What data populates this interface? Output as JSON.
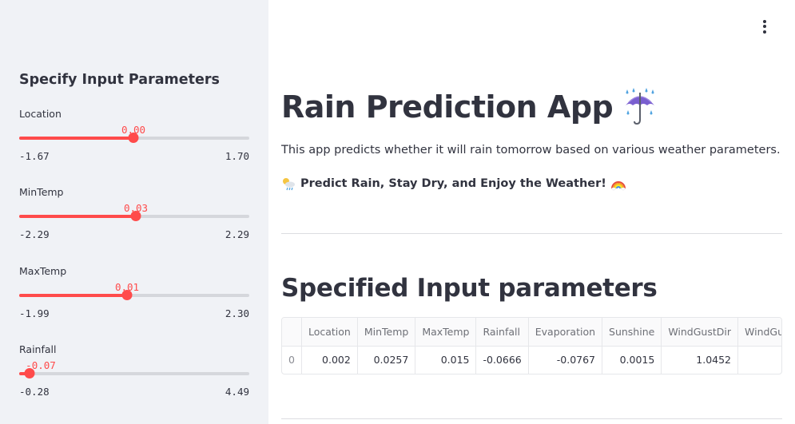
{
  "sidebar": {
    "title": "Specify Input Parameters",
    "sliders": [
      {
        "label": "Location",
        "value": "0.00",
        "min": "-1.67",
        "max": "1.70",
        "fraction": 0.496
      },
      {
        "label": "MinTemp",
        "value": "0.03",
        "min": "-2.29",
        "max": "2.29",
        "fraction": 0.507
      },
      {
        "label": "MaxTemp",
        "value": "0.01",
        "min": "-1.99",
        "max": "2.30",
        "fraction": 0.466
      },
      {
        "label": "Rainfall",
        "value": "-0.07",
        "min": "-0.28",
        "max": "4.49",
        "fraction": 0.044
      }
    ]
  },
  "header": {
    "menu_icon": "kebab-menu-icon"
  },
  "main": {
    "title": "Rain Prediction App",
    "title_icon": "umbrella-with-rain-icon",
    "intro": "This app predicts whether it will rain tomorrow based on various weather parameters.",
    "tagline": "Predict Rain, Stay Dry, and Enjoy the Weather!",
    "tagline_icon_left": "sun-behind-rain-cloud-icon",
    "tagline_icon_right": "rainbow-icon",
    "section_title": "Specified Input parameters",
    "table": {
      "columns": [
        "",
        "Location",
        "MinTemp",
        "MaxTemp",
        "Rainfall",
        "Evaporation",
        "Sunshine",
        "WindGustDir",
        "WindGus"
      ],
      "rows": [
        [
          "0",
          "0.002",
          "0.0257",
          "0.015",
          "-0.0666",
          "-0.0767",
          "0.0015",
          "1.0452",
          ""
        ]
      ]
    }
  },
  "colors": {
    "accent": "#ff4b4b",
    "sidebar_bg": "#f0f2f6",
    "text": "#31333f"
  }
}
